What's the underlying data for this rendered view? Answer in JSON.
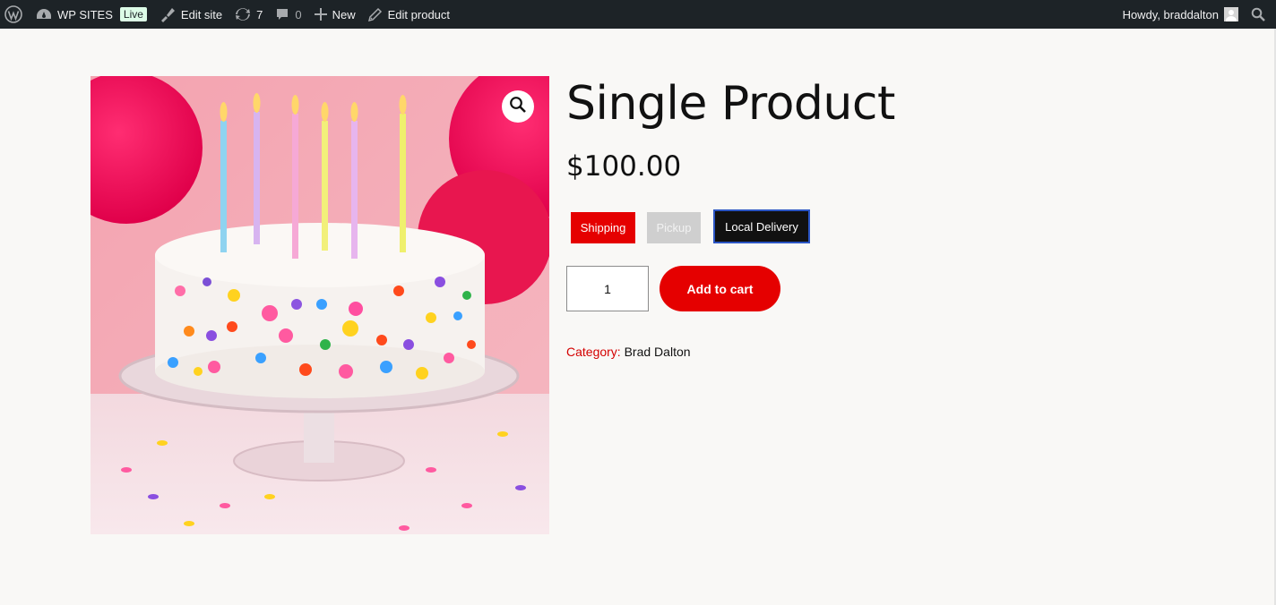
{
  "adminbar": {
    "site_name": "WP SITES",
    "live_badge": "Live",
    "edit_site": "Edit site",
    "updates_count": "7",
    "comments_count": "0",
    "new_label": "New",
    "edit_product": "Edit product",
    "howdy": "Howdy, braddalton"
  },
  "product": {
    "title": "Single Product",
    "price": "$100.00",
    "options": [
      "Shipping",
      "Pickup",
      "Local Delivery"
    ],
    "selected_option": "Local Delivery",
    "quantity": "1",
    "add_to_cart": "Add to cart",
    "category_label": "Category:",
    "category_value": "Brad Dalton"
  },
  "colors": {
    "accent": "#e50000",
    "adminbar_bg": "#1d2327",
    "page_bg": "#f9f8f6",
    "selected_border": "#2b55c4"
  },
  "icons": [
    "wordpress-icon",
    "dashboard-icon",
    "brush-icon",
    "updates-icon",
    "comment-icon",
    "plus-icon",
    "pencil-icon",
    "avatar",
    "search-icon",
    "zoom-icon"
  ]
}
